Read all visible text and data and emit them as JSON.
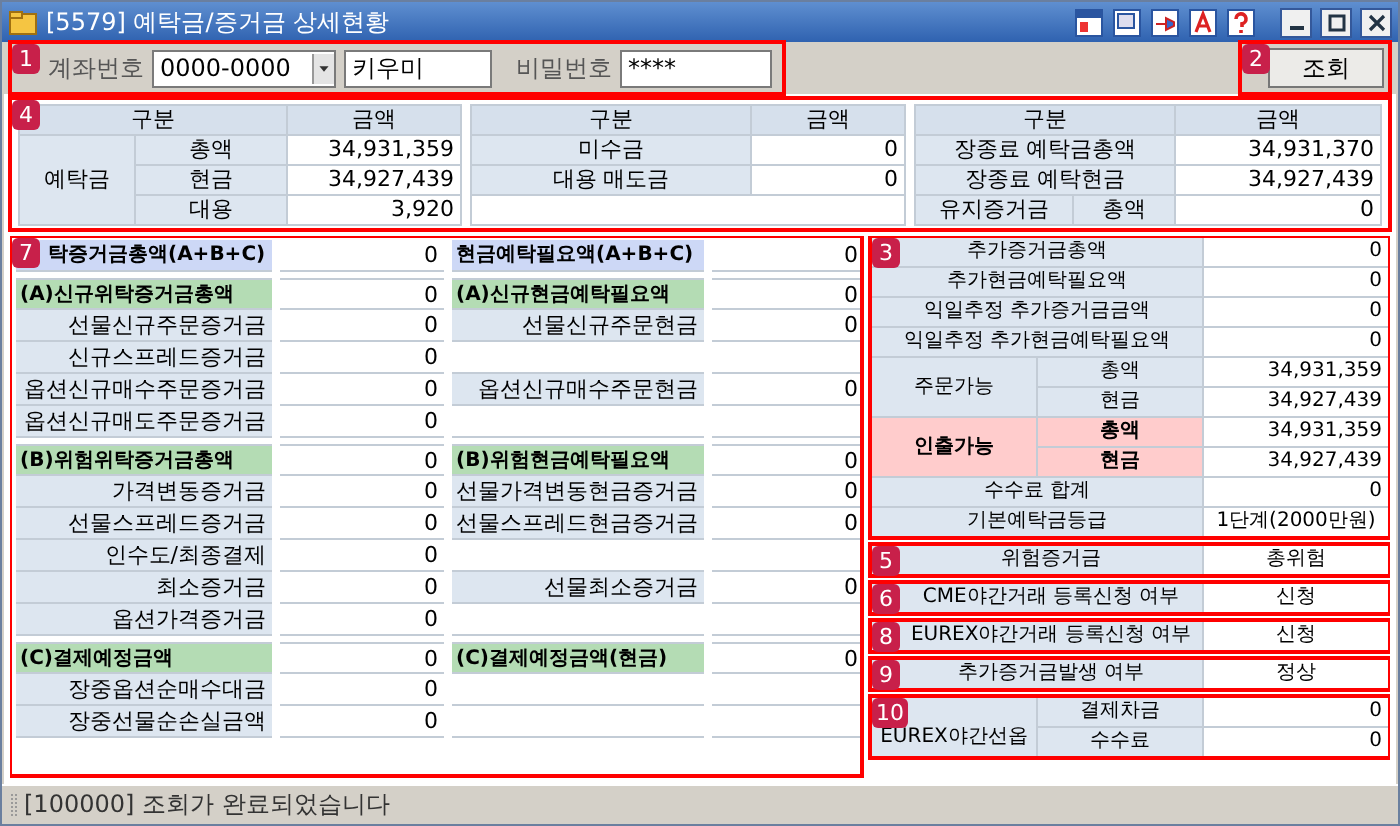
{
  "window": {
    "title": "[5579] 예탁금/증거금 상세현황"
  },
  "query": {
    "badge": "1",
    "account_label": "계좌번호",
    "account": "0000-0000",
    "name": "키우미",
    "password_label": "비밀번호",
    "password": "****"
  },
  "search_button": {
    "badge": "2",
    "label": "조회"
  },
  "summary": {
    "badge": "4",
    "tables": [
      {
        "columns": [
          "구분",
          "금액"
        ],
        "rows": [
          {
            "label": "예탁금",
            "children": [
              {
                "label": "총액",
                "value": "34,931,359"
              },
              {
                "label": "현금",
                "value": "34,927,439"
              },
              {
                "label": "대용",
                "value": "3,920"
              }
            ]
          }
        ]
      },
      {
        "columns": [
          "구분",
          "금액"
        ],
        "rows": [
          {
            "label": "미수금",
            "value": "0"
          },
          {
            "label": "대용 매도금",
            "value": "0"
          }
        ]
      },
      {
        "columns": [
          "구분",
          "금액"
        ],
        "rows": [
          {
            "label": "장종료 예탁금총액",
            "value": "34,931,370"
          },
          {
            "label": "장종료 예탁현금",
            "value": "34,927,439"
          },
          {
            "label": "유지증거금",
            "children": [
              {
                "label": "총액",
                "value": "0"
              }
            ]
          }
        ]
      }
    ]
  },
  "requirements": {
    "badge": "7",
    "rows": [
      {
        "left": {
          "kind": "total",
          "label": "탁증거금총액(A+B+C)",
          "value": "0"
        },
        "middle": {
          "kind": "total",
          "label": "현금예탁필요액(A+B+C)",
          "value": "0"
        }
      },
      {
        "left": {
          "kind": "group",
          "label": "(A)신규위탁증거금총액",
          "value": "0"
        },
        "middle": {
          "kind": "group",
          "label": "(A)신규현금예탁필요액",
          "value": "0"
        }
      },
      {
        "left": {
          "kind": "item",
          "label": "선물신규주문증거금",
          "value": "0"
        },
        "middle": {
          "kind": "item",
          "label": "선물신규주문현금",
          "value": "0"
        }
      },
      {
        "left": {
          "kind": "item",
          "label": "신규스프레드증거금",
          "value": "0"
        }
      },
      {
        "left": {
          "kind": "item",
          "label": "옵션신규매수주문증거금",
          "value": "0"
        },
        "middle": {
          "kind": "item",
          "label": "옵션신규매수주문현금",
          "value": "0"
        }
      },
      {
        "left": {
          "kind": "item",
          "label": "옵션신규매도주문증거금",
          "value": "0"
        }
      },
      {
        "left": {
          "kind": "group",
          "label": "(B)위험위탁증거금총액",
          "value": "0"
        },
        "middle": {
          "kind": "group",
          "label": "(B)위험현금예탁필요액",
          "value": "0"
        }
      },
      {
        "left": {
          "kind": "item",
          "label": "가격변동증거금",
          "value": "0"
        },
        "middle": {
          "kind": "item",
          "label": "선물가격변동현금증거금",
          "value": "0"
        }
      },
      {
        "left": {
          "kind": "item",
          "label": "선물스프레드증거금",
          "value": "0"
        },
        "middle": {
          "kind": "item",
          "label": "선물스프레드현금증거금",
          "value": "0"
        }
      },
      {
        "left": {
          "kind": "item",
          "label": "인수도/최종결제",
          "value": "0"
        }
      },
      {
        "left": {
          "kind": "item",
          "label": "최소증거금",
          "value": "0"
        },
        "middle": {
          "kind": "item",
          "label": "선물최소증거금",
          "value": "0"
        }
      },
      {
        "left": {
          "kind": "item",
          "label": "옵션가격증거금",
          "value": "0"
        }
      },
      {
        "left": {
          "kind": "group",
          "label": "(C)결제예정금액",
          "value": "0"
        },
        "middle": {
          "kind": "group",
          "label": "(C)결제예정금액(현금)",
          "value": "0"
        }
      },
      {
        "left": {
          "kind": "item",
          "label": "장중옵션순매수대금",
          "value": "0"
        }
      },
      {
        "left": {
          "kind": "item",
          "label": "장중선물순손실금액",
          "value": "0"
        }
      }
    ]
  },
  "right_blocks": [
    {
      "badge": "3",
      "rows": [
        {
          "kind": "amount",
          "label": "추가증거금총액",
          "value": "0"
        },
        {
          "kind": "amount",
          "label": "추가현금예탁필요액",
          "value": "0"
        },
        {
          "kind": "amount",
          "label": "익일추정 추가증거금금액",
          "value": "0"
        },
        {
          "kind": "amount",
          "label": "익일추정 추가현금예탁필요액",
          "value": "0"
        },
        {
          "kind": "group",
          "label": "주문가능",
          "emphasis": false,
          "children": [
            {
              "label": "총액",
              "value": "34,931,359"
            },
            {
              "label": "현금",
              "value": "34,927,439"
            }
          ]
        },
        {
          "kind": "group",
          "label": "인출가능",
          "emphasis": true,
          "children": [
            {
              "label": "총액",
              "value": "34,931,359"
            },
            {
              "label": "현금",
              "value": "34,927,439"
            }
          ]
        },
        {
          "kind": "amount",
          "label": "수수료 합계",
          "value": "0"
        },
        {
          "kind": "status",
          "label": "기본예탁금등급",
          "value": "1단계(2000만원)"
        }
      ]
    },
    {
      "badge": "5",
      "rows": [
        {
          "kind": "status",
          "label": "위험증거금",
          "value": "총위험"
        }
      ]
    },
    {
      "badge": "6",
      "rows": [
        {
          "kind": "status",
          "label": "CME야간거래 등록신청 여부",
          "value": "신청"
        }
      ]
    },
    {
      "badge": "8",
      "rows": [
        {
          "kind": "status",
          "label": "EUREX야간거래 등록신청 여부",
          "value": "신청"
        }
      ]
    },
    {
      "badge": "9",
      "rows": [
        {
          "kind": "status",
          "label": "추가증거금발생 여부",
          "value": "정상"
        }
      ]
    },
    {
      "badge": "10",
      "rows": [
        {
          "kind": "group",
          "label": "EUREX야간선옵",
          "emphasis": false,
          "children": [
            {
              "label": "결제차금",
              "value": "0"
            },
            {
              "label": "수수료",
              "value": "0"
            }
          ]
        }
      ]
    }
  ],
  "status_bar": {
    "message": "[100000] 조회가 완료되었습니다"
  }
}
